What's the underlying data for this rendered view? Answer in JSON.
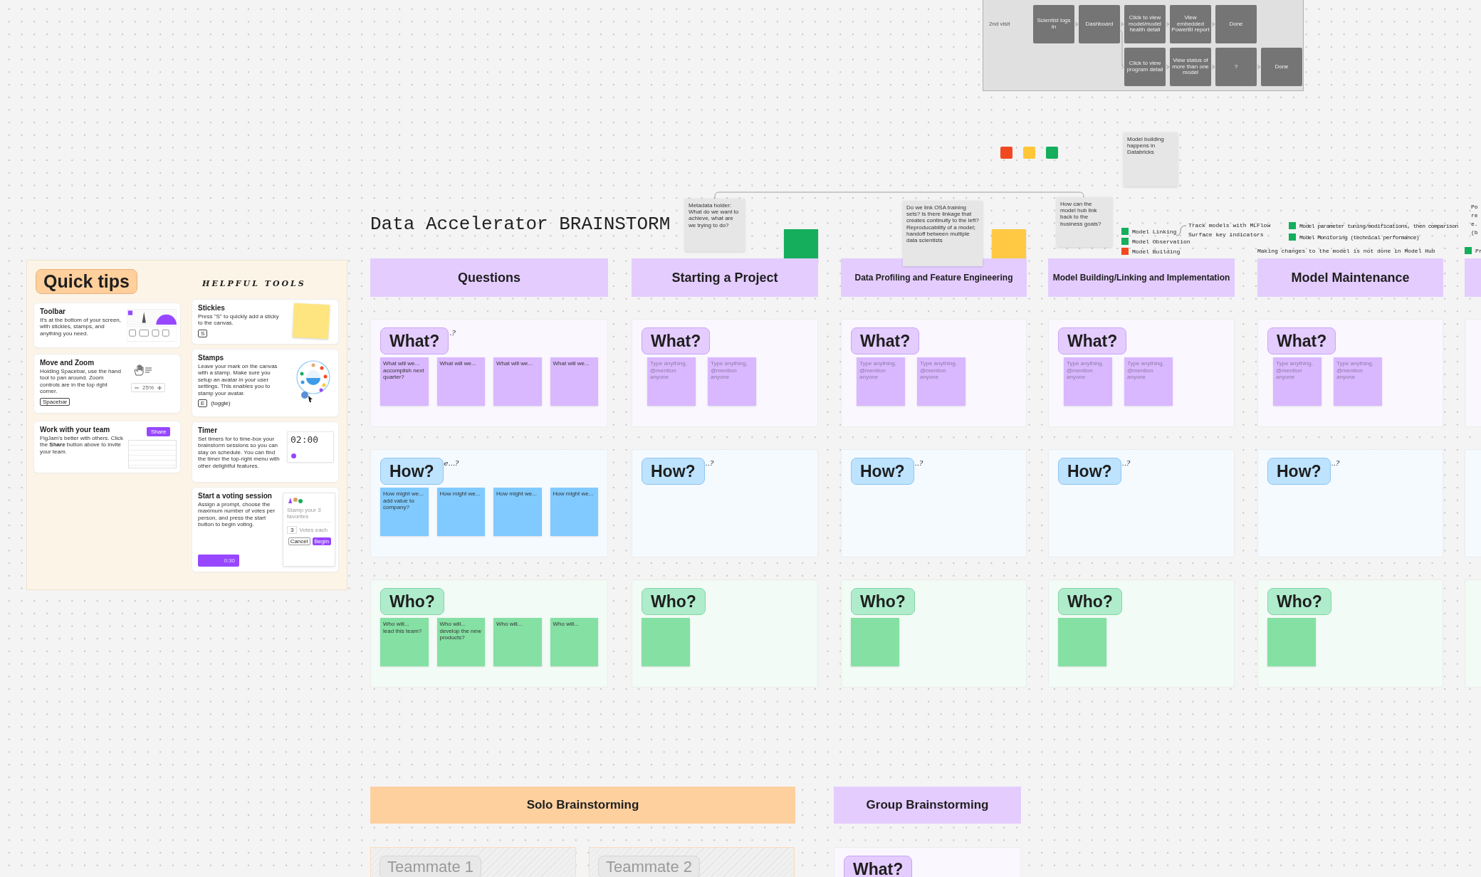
{
  "flow_diagram": {
    "row_label": "2nd visit",
    "rows": [
      [
        "Scientist logs in",
        "Dashboard",
        "Click to view model/model health detail",
        "View embedded PowerBI report",
        "Done"
      ],
      [
        "",
        "",
        "Click to view program detail",
        "View status of more than one model",
        "?",
        "Done"
      ]
    ]
  },
  "color_squares": [
    {
      "color": "#f24822"
    },
    {
      "color": "#ffc738"
    },
    {
      "color": "#14ae5c"
    }
  ],
  "title": "Data Accelerator BRAINSTORM",
  "notes": [
    {
      "text": "Model building happens in Databricks"
    },
    {
      "text": "Metadata holder: What do we want to achieve, what are we trying to do?"
    },
    {
      "text": "Do we link OSA training sets? Is there linkage that creates continuity to the left? Reproducability of a model; handoff between multiple data scientists"
    },
    {
      "text": "How can the model hub link back to the business goals?"
    }
  ],
  "color_blocks": [
    {
      "color": "#14ae5c"
    },
    {
      "color": "#ffc943"
    }
  ],
  "legend": [
    {
      "label": "Model Linking",
      "color": "#14ae5c"
    },
    {
      "label": "Model Observation",
      "color": "#14ae5c"
    },
    {
      "label": "Model Building",
      "color": "#f24822"
    }
  ],
  "annotations": [
    "Track models with MLFlow",
    "Surface key indicators"
  ],
  "maintenance_notes": [
    {
      "label": "Model parameter tuning/modifications, then comparison",
      "color": "#14ae5c"
    },
    {
      "label": "Model Monitoring (technical performance)",
      "color": "#14ae5c"
    }
  ],
  "making_changes_note": "Making changes to the model is not done in Model Hub",
  "edge_note": [
    "Po",
    "re",
    "e.",
    "(b"
  ],
  "edge_legend": {
    "label": "Pr",
    "color": "#14ae5c"
  },
  "quick_tips": {
    "title": "Quick tips",
    "subtitle": "HELPFUL TOOLS",
    "cards": [
      {
        "kind": "toolbar",
        "title": "Toolbar",
        "text": "It's at the bottom of your screen, with stickies, stamps, and anything you need."
      },
      {
        "kind": "move",
        "title": "Move and Zoom",
        "text": "Holding Spacebar, use the hand tool to pan around. Zoom controls are in the top right corner.",
        "key": "Spacebar",
        "zoom": "25%"
      },
      {
        "kind": "team",
        "title": "Work with your team",
        "text": "FigJam's better with others. Click the **Share** button above to invite your team.",
        "button": "Share"
      },
      {
        "kind": "stickies",
        "title": "Stickies",
        "text": "Press \"S\" to quickly add a sticky to the canvas.",
        "key": "S"
      },
      {
        "kind": "stamps",
        "title": "Stamps",
        "text": "Leave your mark on the canvas with a stamp. Make sure you setup an avatar in your user settings. This enables you to stamp your avatar.",
        "key": "E",
        "key_note": "(toggle)"
      },
      {
        "kind": "timer",
        "title": "Timer",
        "text": "Set timers for to time-box your brainstorm sessions so you can stay on schedule. You can find the timer the top-right menu with other delightful features.",
        "time": "02:00"
      },
      {
        "kind": "voting",
        "title": "Start a voting session",
        "text": "Assign a prompt, choose the maximum number of votes per person, and press the start button to begin voting.",
        "button_time": "0:30",
        "prompt": "Stamp your 3 favorites",
        "votes": "3",
        "votes_label": "Votes each",
        "cancel": "Cancel",
        "begin": "Begin"
      }
    ]
  },
  "columns": [
    {
      "header": "Questions",
      "sections": [
        {
          "kind": "what",
          "tag": "What?",
          "hint": ".?",
          "stickies": [
            {
              "kind": "note",
              "text": "What will we...\naccomplish next quarter?"
            },
            {
              "kind": "note",
              "text": "What will we..."
            },
            {
              "kind": "note",
              "text": "What will we..."
            },
            {
              "kind": "note",
              "text": "What will we..."
            }
          ]
        },
        {
          "kind": "how",
          "tag": "How?",
          "hint": "e...?",
          "stickies": [
            {
              "kind": "note",
              "text": "How might we...\nadd value to company?"
            },
            {
              "kind": "note",
              "text": "How might we..."
            },
            {
              "kind": "note",
              "text": "How might we..."
            },
            {
              "kind": "note",
              "text": "How might we..."
            }
          ]
        },
        {
          "kind": "who",
          "tag": "Who?",
          "stickies": [
            {
              "kind": "note",
              "text": "Who will...\nlead this team?"
            },
            {
              "kind": "note",
              "text": "Who will...\ndevelop the new products?"
            },
            {
              "kind": "note",
              "text": "Who will..."
            },
            {
              "kind": "note",
              "text": "Who will..."
            }
          ]
        }
      ]
    },
    {
      "header": "Starting a Project",
      "sections": [
        {
          "kind": "what",
          "tag": "What?",
          "stickies": [
            {
              "kind": "placeholder",
              "text": "Type anything, @mention anyone"
            },
            {
              "kind": "placeholder",
              "text": "Type anything, @mention anyone"
            }
          ]
        },
        {
          "kind": "how",
          "tag": "How?",
          "hint": "..?"
        },
        {
          "kind": "who",
          "tag": "Who?",
          "stickies": [
            {
              "kind": "empty"
            }
          ]
        }
      ]
    },
    {
      "header": "Data Profiling and Feature Engineering",
      "sections": [
        {
          "kind": "what",
          "tag": "What?",
          "stickies": [
            {
              "kind": "placeholder",
              "text": "Type anything, @mention anyone"
            },
            {
              "kind": "placeholder",
              "text": "Type anything, @mention anyone"
            }
          ]
        },
        {
          "kind": "how",
          "tag": "How?",
          "hint": "..?"
        },
        {
          "kind": "who",
          "tag": "Who?",
          "stickies": [
            {
              "kind": "empty"
            }
          ]
        }
      ]
    },
    {
      "header": "Model Building/Linking and Implementation",
      "sections": [
        {
          "kind": "what",
          "tag": "What?",
          "stickies": [
            {
              "kind": "placeholder",
              "text": "Type anything, @mention anyone"
            },
            {
              "kind": "placeholder",
              "text": "Type anything, @mention anyone"
            }
          ]
        },
        {
          "kind": "how",
          "tag": "How?",
          "hint": "..?"
        },
        {
          "kind": "who",
          "tag": "Who?",
          "stickies": [
            {
              "kind": "empty"
            }
          ]
        }
      ]
    },
    {
      "header": "Model Maintenance",
      "sections": [
        {
          "kind": "what",
          "tag": "What?",
          "stickies": [
            {
              "kind": "placeholder",
              "text": "Type anything, @mention anyone"
            },
            {
              "kind": "placeholder",
              "text": "Type anything, @mention anyone"
            }
          ]
        },
        {
          "kind": "how",
          "tag": "How?",
          "hint": "..?"
        },
        {
          "kind": "who",
          "tag": "Who?",
          "stickies": [
            {
              "kind": "empty"
            }
          ]
        }
      ]
    }
  ],
  "bottom_sections": [
    {
      "kind": "solo",
      "header": "Solo Brainstorming",
      "teammates": [
        "Teammate 1",
        "Teammate 2"
      ]
    },
    {
      "kind": "group",
      "header": "Group Brainstorming",
      "tag": "What?"
    }
  ]
}
